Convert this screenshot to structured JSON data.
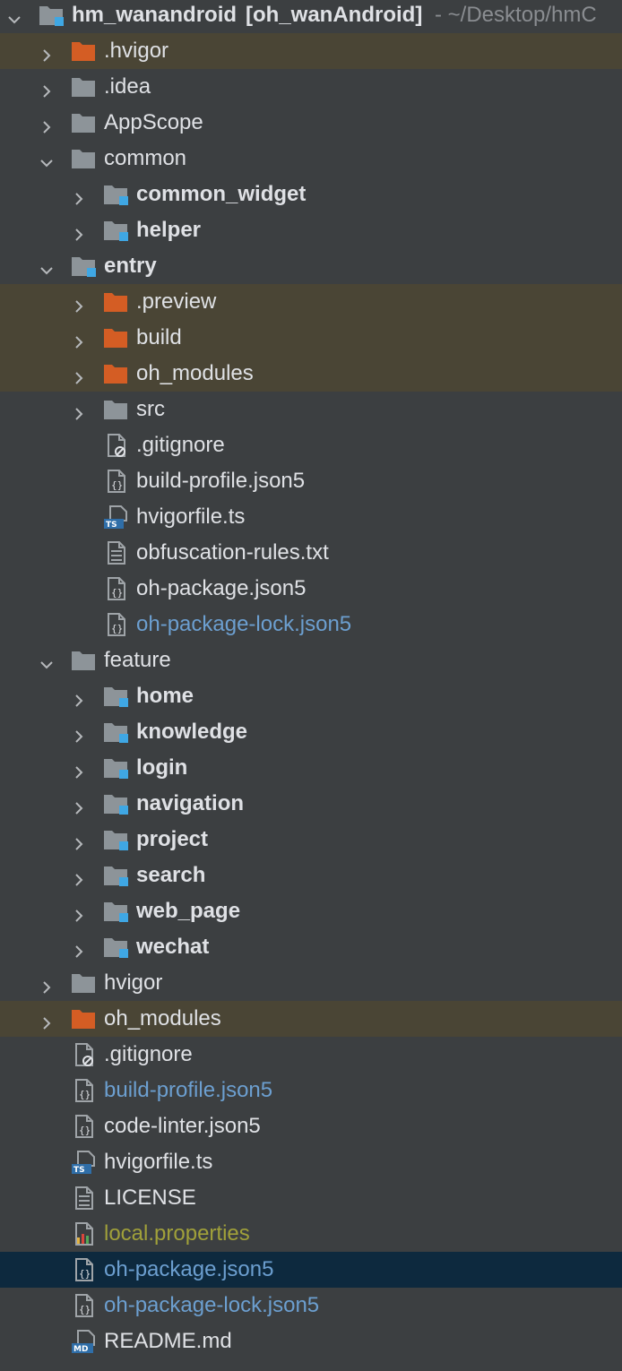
{
  "colors": {
    "background": "#3c3f41",
    "text": "#dfe1e5",
    "excluded_row_bg": "#4a4535",
    "selected_row_bg": "#0d293e",
    "folder_gray": "#8d9499",
    "folder_orange": "#d45d24",
    "module_marker": "#3fa7e4",
    "vcs_blue_text": "#6c9fd0",
    "vcs_olive_text": "#a0a03a"
  },
  "tree": [
    {
      "label": "hm_wanandroid",
      "bold_suffix": "[oh_wanAndroid]",
      "path_suffix": "- ~/Desktop/hmC",
      "depth": 0,
      "arrow": "down",
      "icon": "module-folder",
      "bold": true,
      "style": "",
      "bg": ""
    },
    {
      "label": ".hvigor",
      "depth": 1,
      "arrow": "right",
      "icon": "excluded-folder",
      "bold": false,
      "style": "",
      "bg": "excluded"
    },
    {
      "label": ".idea",
      "depth": 1,
      "arrow": "right",
      "icon": "folder",
      "bold": false,
      "style": "",
      "bg": ""
    },
    {
      "label": "AppScope",
      "depth": 1,
      "arrow": "right",
      "icon": "folder",
      "bold": false,
      "style": "",
      "bg": ""
    },
    {
      "label": "common",
      "depth": 1,
      "arrow": "down",
      "icon": "folder",
      "bold": false,
      "style": "",
      "bg": ""
    },
    {
      "label": "common_widget",
      "depth": 2,
      "arrow": "right",
      "icon": "module-folder",
      "bold": true,
      "style": "",
      "bg": ""
    },
    {
      "label": "helper",
      "depth": 2,
      "arrow": "right",
      "icon": "module-folder",
      "bold": true,
      "style": "",
      "bg": ""
    },
    {
      "label": "entry",
      "depth": 1,
      "arrow": "down",
      "icon": "module-folder",
      "bold": true,
      "style": "",
      "bg": ""
    },
    {
      "label": ".preview",
      "depth": 2,
      "arrow": "right",
      "icon": "excluded-folder",
      "bold": false,
      "style": "",
      "bg": "excluded"
    },
    {
      "label": "build",
      "depth": 2,
      "arrow": "right",
      "icon": "excluded-folder",
      "bold": false,
      "style": "",
      "bg": "excluded"
    },
    {
      "label": "oh_modules",
      "depth": 2,
      "arrow": "right",
      "icon": "excluded-folder",
      "bold": false,
      "style": "",
      "bg": "excluded"
    },
    {
      "label": "src",
      "depth": 2,
      "arrow": "right",
      "icon": "folder",
      "bold": false,
      "style": "",
      "bg": ""
    },
    {
      "label": ".gitignore",
      "depth": 2,
      "arrow": "",
      "icon": "ignore-file",
      "bold": false,
      "style": "",
      "bg": ""
    },
    {
      "label": "build-profile.json5",
      "depth": 2,
      "arrow": "",
      "icon": "json-file",
      "bold": false,
      "style": "",
      "bg": ""
    },
    {
      "label": "hvigorfile.ts",
      "depth": 2,
      "arrow": "",
      "icon": "ts-file",
      "bold": false,
      "style": "",
      "bg": ""
    },
    {
      "label": "obfuscation-rules.txt",
      "depth": 2,
      "arrow": "",
      "icon": "text-file",
      "bold": false,
      "style": "",
      "bg": ""
    },
    {
      "label": "oh-package.json5",
      "depth": 2,
      "arrow": "",
      "icon": "json-file",
      "bold": false,
      "style": "",
      "bg": ""
    },
    {
      "label": "oh-package-lock.json5",
      "depth": 2,
      "arrow": "",
      "icon": "json-file",
      "bold": false,
      "style": "blue",
      "bg": ""
    },
    {
      "label": "feature",
      "depth": 1,
      "arrow": "down",
      "icon": "folder",
      "bold": false,
      "style": "",
      "bg": ""
    },
    {
      "label": "home",
      "depth": 2,
      "arrow": "right",
      "icon": "module-folder",
      "bold": true,
      "style": "",
      "bg": ""
    },
    {
      "label": "knowledge",
      "depth": 2,
      "arrow": "right",
      "icon": "module-folder",
      "bold": true,
      "style": "",
      "bg": ""
    },
    {
      "label": "login",
      "depth": 2,
      "arrow": "right",
      "icon": "module-folder",
      "bold": true,
      "style": "",
      "bg": ""
    },
    {
      "label": "navigation",
      "depth": 2,
      "arrow": "right",
      "icon": "module-folder",
      "bold": true,
      "style": "",
      "bg": ""
    },
    {
      "label": "project",
      "depth": 2,
      "arrow": "right",
      "icon": "module-folder",
      "bold": true,
      "style": "",
      "bg": ""
    },
    {
      "label": "search",
      "depth": 2,
      "arrow": "right",
      "icon": "module-folder",
      "bold": true,
      "style": "",
      "bg": ""
    },
    {
      "label": "web_page",
      "depth": 2,
      "arrow": "right",
      "icon": "module-folder",
      "bold": true,
      "style": "",
      "bg": ""
    },
    {
      "label": "wechat",
      "depth": 2,
      "arrow": "right",
      "icon": "module-folder",
      "bold": true,
      "style": "",
      "bg": ""
    },
    {
      "label": "hvigor",
      "depth": 1,
      "arrow": "right",
      "icon": "folder",
      "bold": false,
      "style": "",
      "bg": ""
    },
    {
      "label": "oh_modules",
      "depth": 1,
      "arrow": "right",
      "icon": "excluded-folder",
      "bold": false,
      "style": "",
      "bg": "excluded"
    },
    {
      "label": ".gitignore",
      "depth": 1,
      "arrow": "",
      "icon": "ignore-file",
      "bold": false,
      "style": "",
      "bg": ""
    },
    {
      "label": "build-profile.json5",
      "depth": 1,
      "arrow": "",
      "icon": "json-file",
      "bold": false,
      "style": "blue",
      "bg": ""
    },
    {
      "label": "code-linter.json5",
      "depth": 1,
      "arrow": "",
      "icon": "json-file",
      "bold": false,
      "style": "",
      "bg": ""
    },
    {
      "label": "hvigorfile.ts",
      "depth": 1,
      "arrow": "",
      "icon": "ts-file",
      "bold": false,
      "style": "",
      "bg": ""
    },
    {
      "label": "LICENSE",
      "depth": 1,
      "arrow": "",
      "icon": "text-file",
      "bold": false,
      "style": "",
      "bg": ""
    },
    {
      "label": "local.properties",
      "depth": 1,
      "arrow": "",
      "icon": "properties-file",
      "bold": false,
      "style": "olive",
      "bg": ""
    },
    {
      "label": "oh-package.json5",
      "depth": 1,
      "arrow": "",
      "icon": "json-file",
      "bold": false,
      "style": "blue",
      "bg": "selected"
    },
    {
      "label": "oh-package-lock.json5",
      "depth": 1,
      "arrow": "",
      "icon": "json-file",
      "bold": false,
      "style": "blue",
      "bg": ""
    },
    {
      "label": "README.md",
      "depth": 1,
      "arrow": "",
      "icon": "md-file",
      "bold": false,
      "style": "",
      "bg": ""
    }
  ]
}
